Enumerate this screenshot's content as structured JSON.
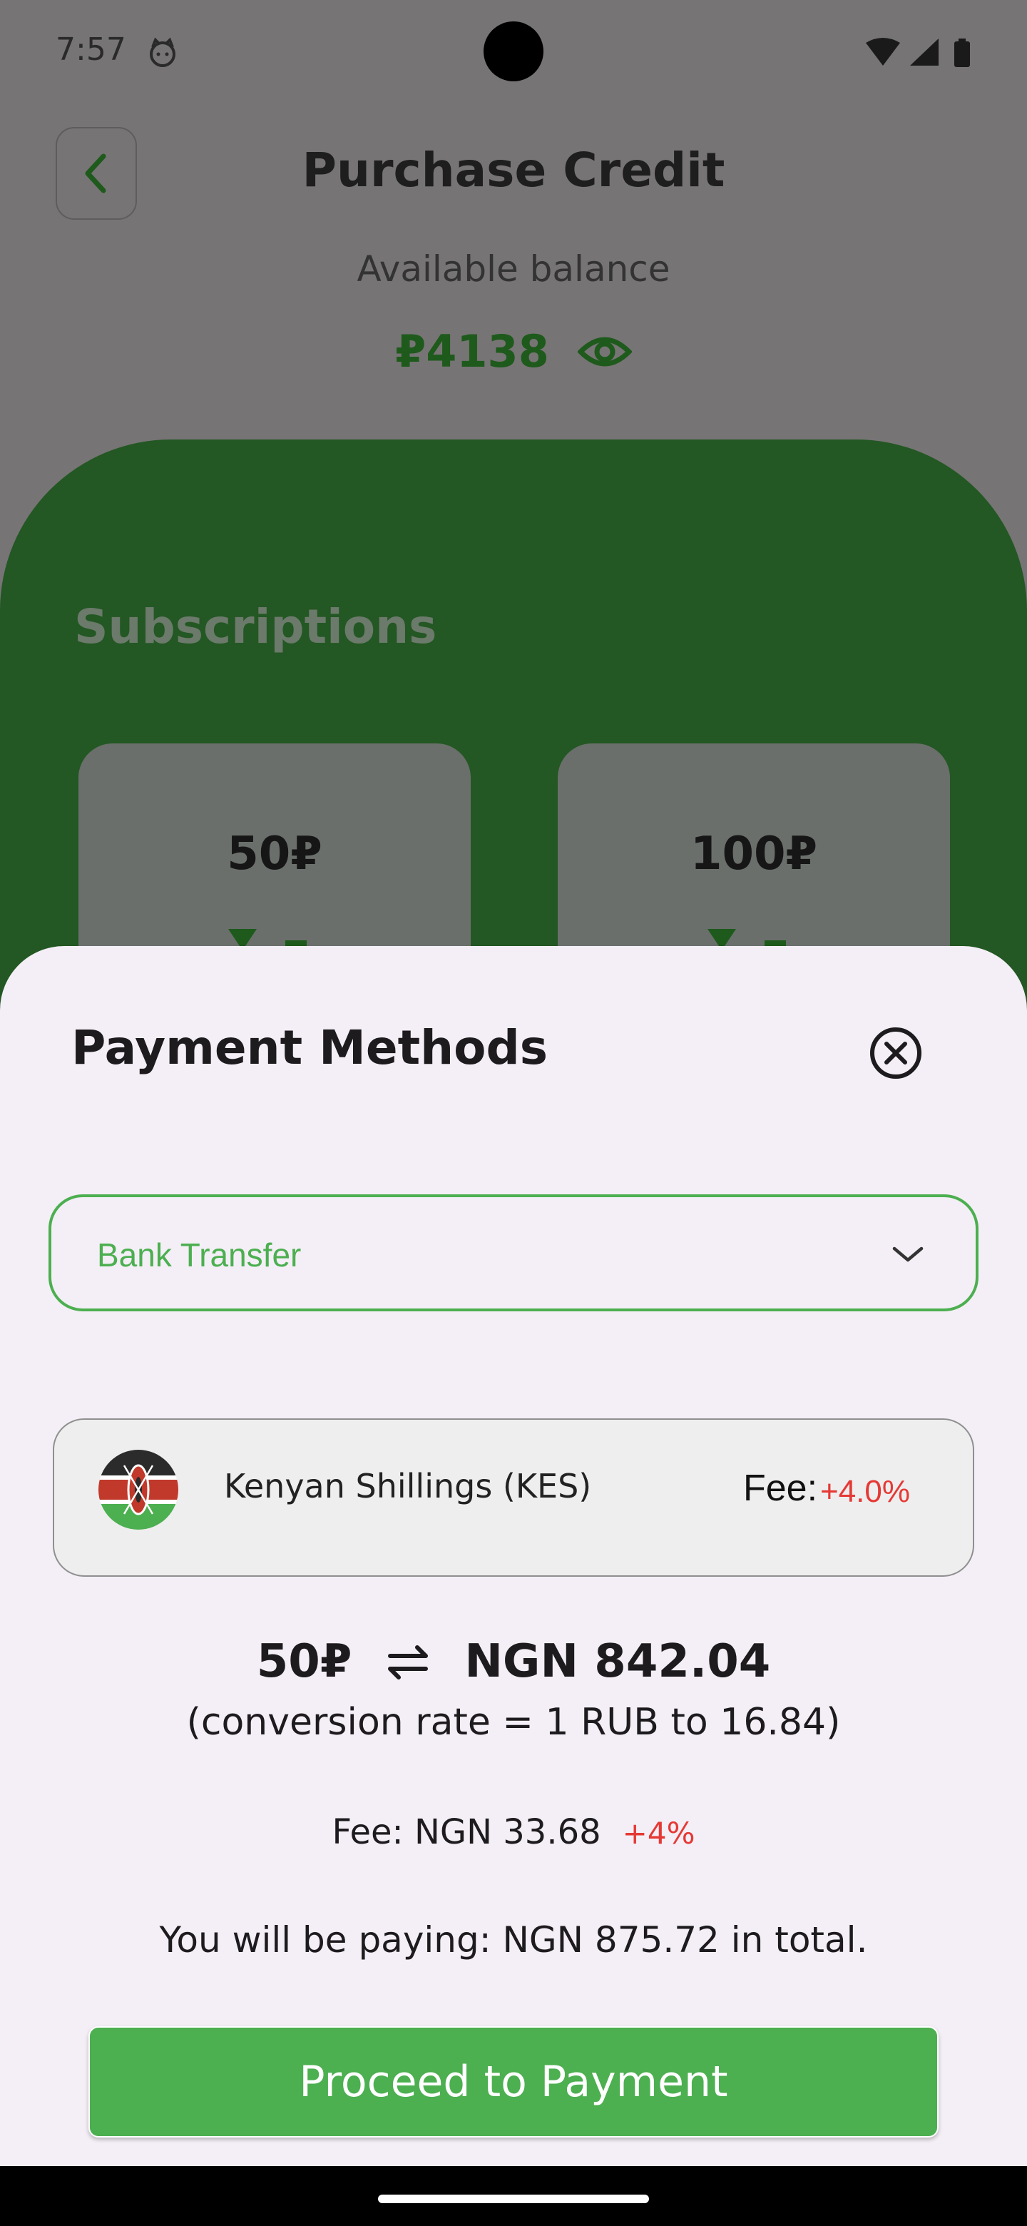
{
  "status_bar": {
    "time": "7:57"
  },
  "header": {
    "title": "Purchase Credit",
    "balance_label": "Available balance",
    "balance_value": "₽4138"
  },
  "subscriptions": {
    "title": "Subscriptions",
    "cards": [
      {
        "price": "50₽"
      },
      {
        "price": "100₽"
      }
    ]
  },
  "sheet": {
    "title": "Payment Methods",
    "dropdown": {
      "selected": "Bank Transfer"
    },
    "currency": {
      "name": "Kenyan Shillings (KES)",
      "fee_label": "Fee:",
      "fee_percent": "+4.0%"
    },
    "conversion": {
      "from": "50₽",
      "to": "NGN 842.04",
      "rate_text": "(conversion rate = 1 RUB to 16.84)"
    },
    "fee": {
      "text": "Fee:  NGN 33.68",
      "percent": "+4%"
    },
    "total_text": "You will be paying: NGN 875.72 in total.",
    "proceed_label": "Proceed to Payment"
  },
  "colors": {
    "accent_green": "#4caf50",
    "dark_green": "#235723",
    "fee_red": "#e53935"
  },
  "icons": [
    "back-arrow-icon",
    "eye-icon",
    "close-circle-icon",
    "chevron-down-icon",
    "swap-arrows-icon",
    "kenya-flag-icon",
    "wifi-icon",
    "signal-icon",
    "battery-icon"
  ]
}
